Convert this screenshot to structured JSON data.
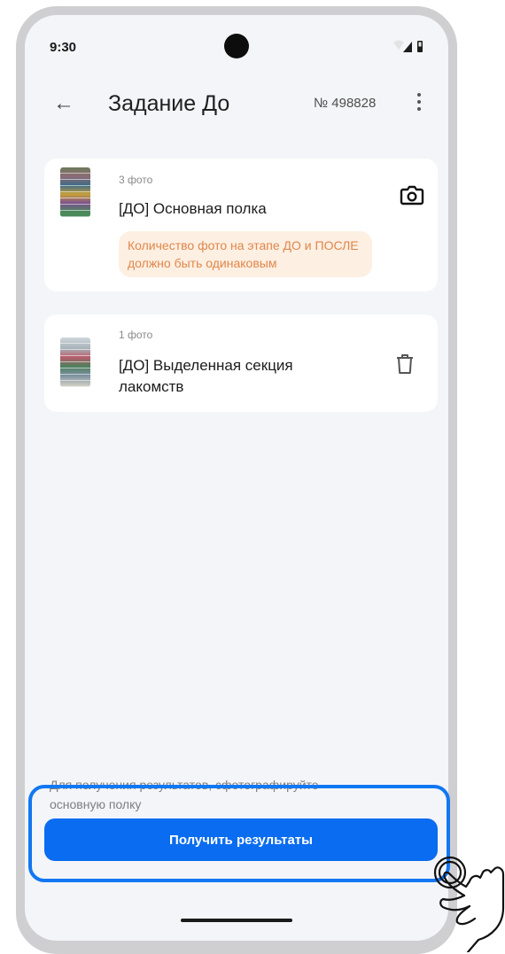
{
  "status_bar": {
    "time": "9:30"
  },
  "appbar": {
    "title": "Задание До",
    "number": "№ 498828"
  },
  "tasks": [
    {
      "count": "3 фото",
      "title": "[ДО] Основная полка",
      "warning": "Количество фото на этапе ДО и ПОСЛЕ должно быть одинаковым",
      "action_icon": "camera-icon"
    },
    {
      "count": "1 фото",
      "title": "[ДО] Выделенная секция лакомств",
      "action_icon": "trash-icon"
    }
  ],
  "footer": {
    "hint_line1": "Для получения результатов, сфотографируйте",
    "hint_line2": "основную полку",
    "button_label": "Получить результаты"
  },
  "colors": {
    "accent": "#0a6cf0",
    "warning_bg": "#fdefe2",
    "warning_text": "#e0874a",
    "highlight": "#1277f2"
  }
}
